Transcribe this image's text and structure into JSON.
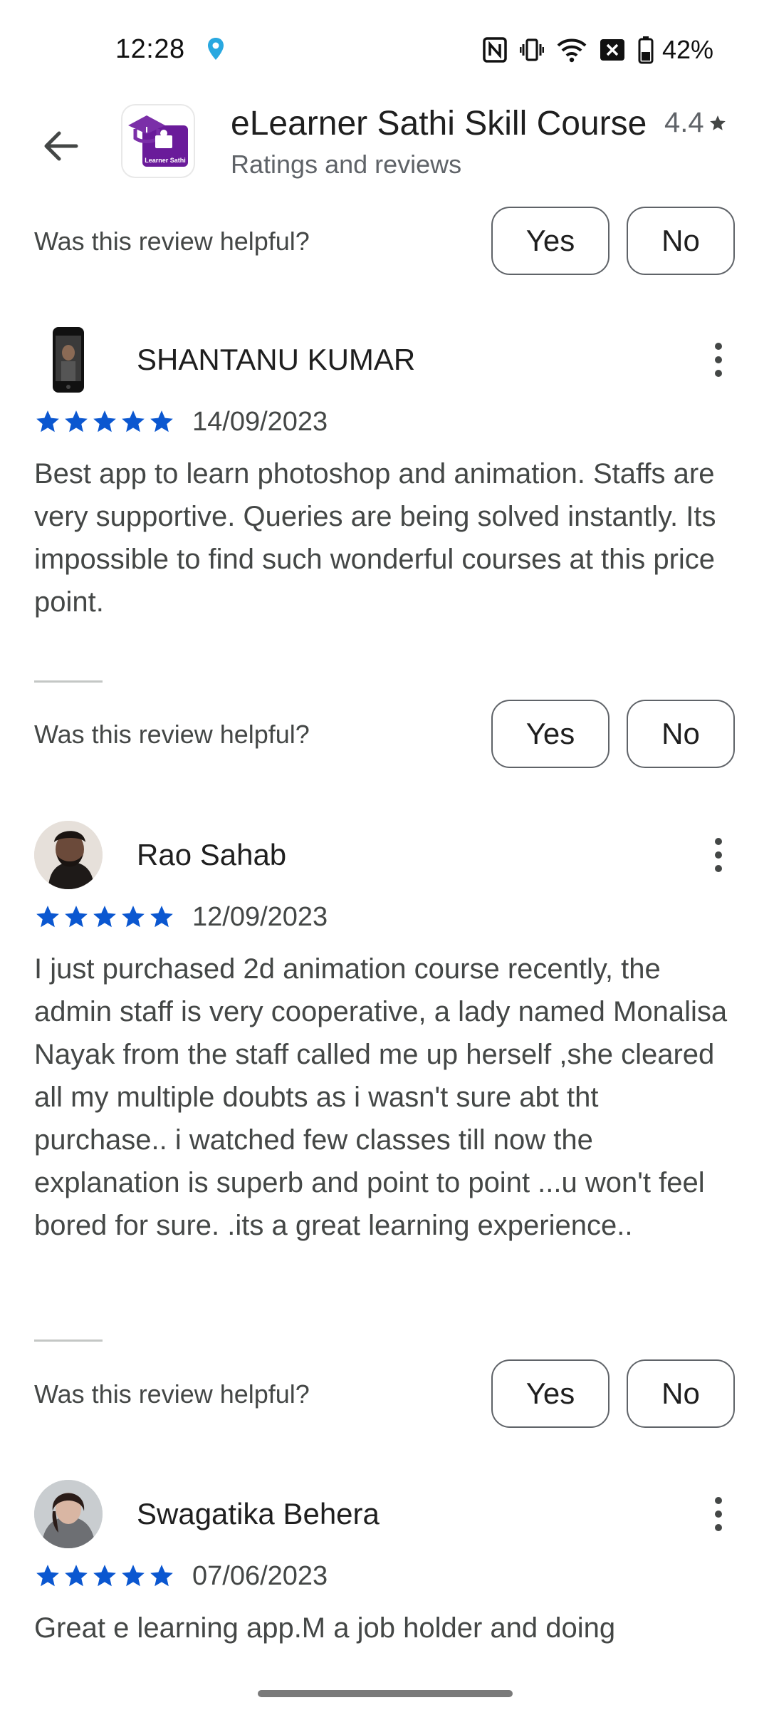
{
  "status_bar": {
    "time": "12:28",
    "battery": "42%",
    "icons": [
      "location-icon",
      "nfc-icon",
      "vibrate-icon",
      "wifi-icon",
      "no-sim-icon",
      "battery-icon"
    ]
  },
  "header": {
    "app_name": "eLearner Sathi Skill Course",
    "subtitle": "Ratings and reviews",
    "rating": "4.4",
    "app_icon_text": "Learner Sathi"
  },
  "colors": {
    "star": "#0b57d0",
    "app_icon_purple": "#6a1b9a",
    "text_primary": "#1f1f1f",
    "text_secondary": "#444746"
  },
  "helpful": {
    "question": "Was this review helpful?",
    "yes": "Yes",
    "no": "No"
  },
  "reviews": [
    {
      "name": "SHANTANU KUMAR",
      "stars": 5,
      "date": "14/09/2023",
      "text": "Best app to learn photoshop and animation. Staffs are very supportive. Queries are being solved instantly. Its impossible to find such wonderful courses at this price point."
    },
    {
      "name": "Rao Sahab",
      "stars": 5,
      "date": "12/09/2023",
      "text": "I just purchased 2d animation course recently, the admin staff is very cooperative, a lady named Monalisa Nayak from the staff called me up herself ,she cleared all my multiple doubts as i wasn't sure abt tht purchase.. i watched few classes till now the explanation is superb and point to point ...u won't feel bored for sure. .its a great learning experience.."
    },
    {
      "name": "Swagatika Behera",
      "stars": 5,
      "date": "07/06/2023",
      "text": "Great e learning app.M a job holder and doing"
    }
  ]
}
